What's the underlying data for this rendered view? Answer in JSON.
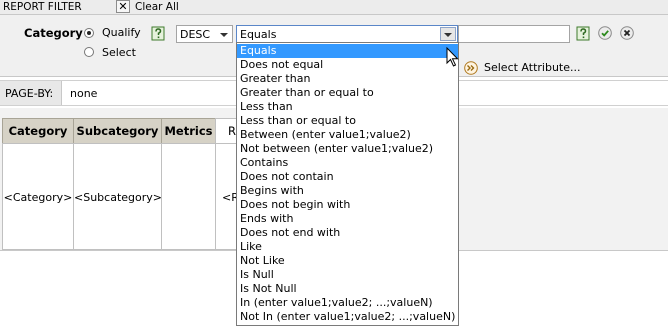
{
  "title_bar": {
    "title": "REPORT FILTER",
    "close_glyph": "✕",
    "clear_all": "Clear All"
  },
  "filter": {
    "attribute": "Category",
    "qualify_label": "Qualify",
    "select_label": "Select",
    "qualify_selected": true,
    "form_value": "DESC",
    "operator_value": "Equals",
    "value_input": "",
    "select_attribute_label": "Select Attribute..."
  },
  "page_by": {
    "label": "PAGE-BY:",
    "value": "none"
  },
  "grid": {
    "headers": [
      "Category",
      "Subcategory",
      "Metrics",
      "R"
    ],
    "row": [
      "<Category>",
      "<Subcategory>",
      "",
      "<R"
    ]
  },
  "operator_options": [
    "Equals",
    "Does not equal",
    "Greater than",
    "Greater than or equal to",
    "Less than",
    "Less than or equal to",
    "Between (enter value1;value2)",
    "Not between (enter value1;value2)",
    "Contains",
    "Does not contain",
    "Begins with",
    "Does not begin with",
    "Ends with",
    "Does not end with",
    "Like",
    "Not Like",
    "Is Null",
    "Is Not Null",
    "In (enter value1;value2; ...;valueN)",
    "Not In (enter value1;value2; ...;valueN)"
  ],
  "selected_option_index": 0,
  "colors": {
    "selection": "#3399ff",
    "header_fill": "#d6d2c6",
    "panel": "#f0f0f0"
  },
  "icons": [
    "close-icon",
    "help-icon",
    "dropdown-arrow-icon",
    "ok-check-icon",
    "cancel-x-icon",
    "select-attribute-icon",
    "mouse-cursor-icon"
  ]
}
